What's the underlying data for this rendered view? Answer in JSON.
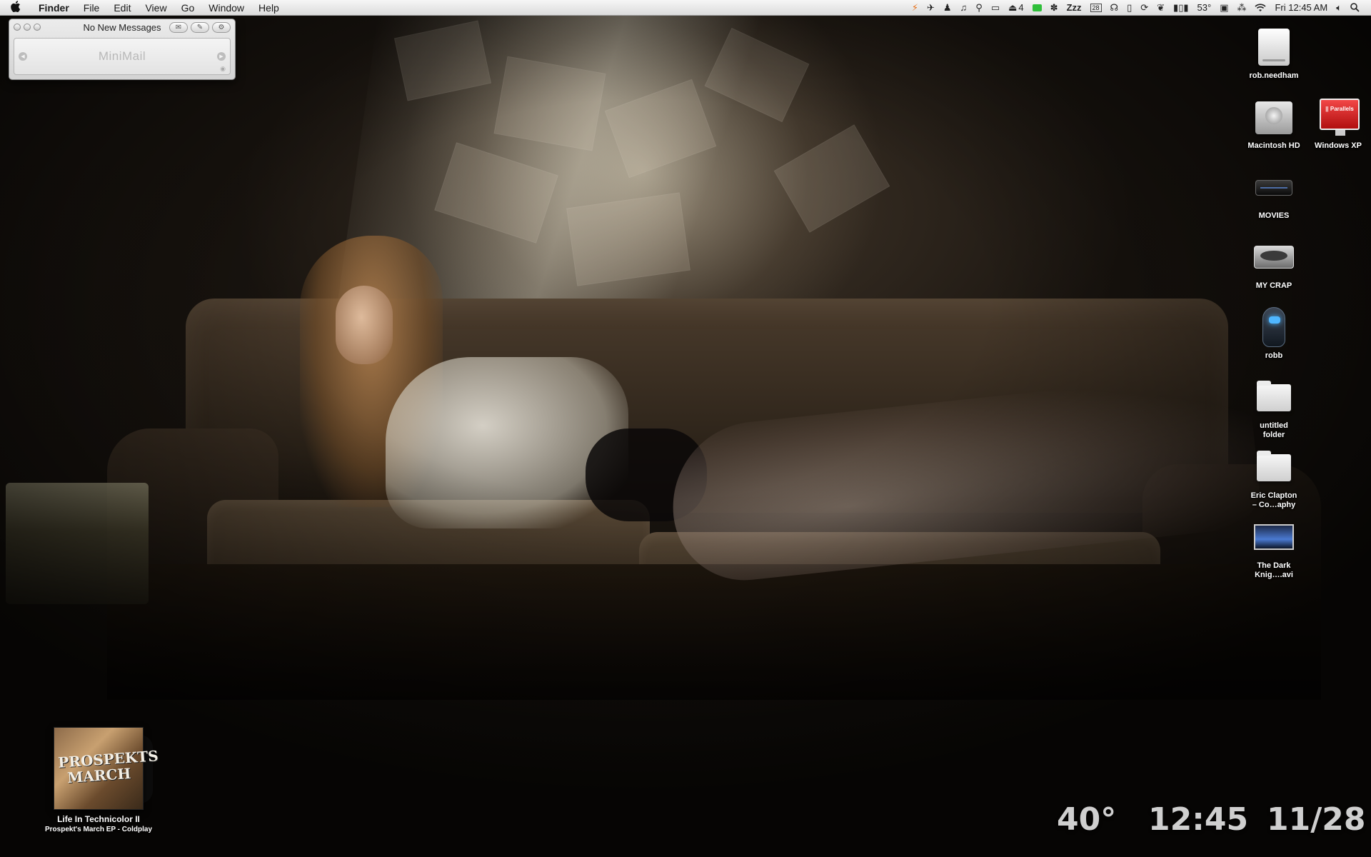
{
  "menubar": {
    "apple_label": "",
    "app_name": "Finder",
    "menus": [
      "File",
      "Edit",
      "View",
      "Go",
      "Window",
      "Help"
    ],
    "status": {
      "eject_count": "4",
      "temperature": "53°",
      "clock": "Fri 12:45 AM",
      "calendar_day": "28"
    }
  },
  "minimail": {
    "title": "No New Messages",
    "logo": "MiniMail"
  },
  "desktop_icons": [
    {
      "label": "rob.needham",
      "icon": "external-drive-icon"
    },
    {
      "label": "Macintosh HD",
      "icon": "hard-drive-icon"
    },
    {
      "label": "Windows XP",
      "icon": "parallels-icon"
    },
    {
      "label": "MOVIES",
      "icon": "black-drive-icon"
    },
    {
      "label": "MY CRAP",
      "icon": "open-drive-icon"
    },
    {
      "label": "robb",
      "icon": "robot-icon"
    },
    {
      "label": "untitled folder",
      "icon": "folder-icon"
    },
    {
      "label": "Eric Clapton – Co…aphy",
      "icon": "folder-icon"
    },
    {
      "label": "The Dark Knig….avi",
      "icon": "movie-file-icon"
    }
  ],
  "now_playing": {
    "album_art_text": "PROSPEKTS MARCH",
    "track": "Life In Technicolor II",
    "album_artist": "Prospekt's March EP - Coldplay"
  },
  "widgets": {
    "temperature": "40°",
    "time": "12:45",
    "date": "11/28"
  }
}
